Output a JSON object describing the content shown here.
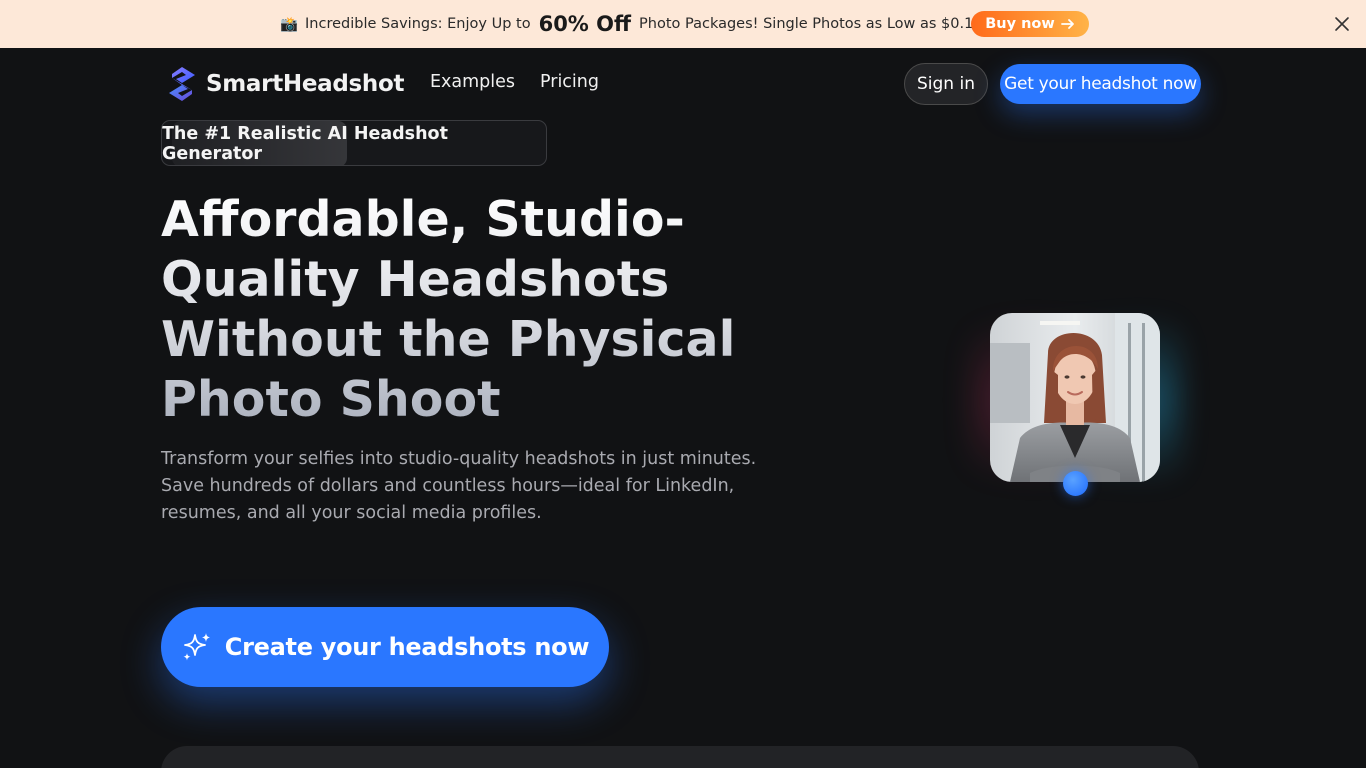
{
  "banner": {
    "emoji": "📸",
    "text_before": "Incredible Savings: Enjoy Up to",
    "highlight": "60% Off",
    "text_after": "Photo Packages! Single Photos as Low as $0.18!",
    "buy_label": "Buy now",
    "close_icon": "close-icon"
  },
  "nav": {
    "brand": "SmartHeadshot",
    "links": [
      "Examples",
      "Pricing"
    ],
    "signin_label": "Sign in",
    "cta_label": "Get your headshot now"
  },
  "hero": {
    "badge": "The #1 Realistic AI Headshot Generator",
    "title_lines": [
      "Affordable, Studio-",
      "Quality Headshots",
      "Without the Physical",
      "Photo Shoot"
    ],
    "subtitle_lines": [
      "Transform your selfies into studio-quality headshots in just minutes.",
      "Save hundreds of dollars and countless hours—ideal for LinkedIn,",
      "resumes, and all your social media profiles."
    ],
    "cta_label": "Create your headshots now",
    "cta_icon": "sparkles-icon"
  },
  "colors": {
    "accent": "#2a77ff",
    "banner_bg": "#fde8d8",
    "page_bg": "#111214"
  }
}
